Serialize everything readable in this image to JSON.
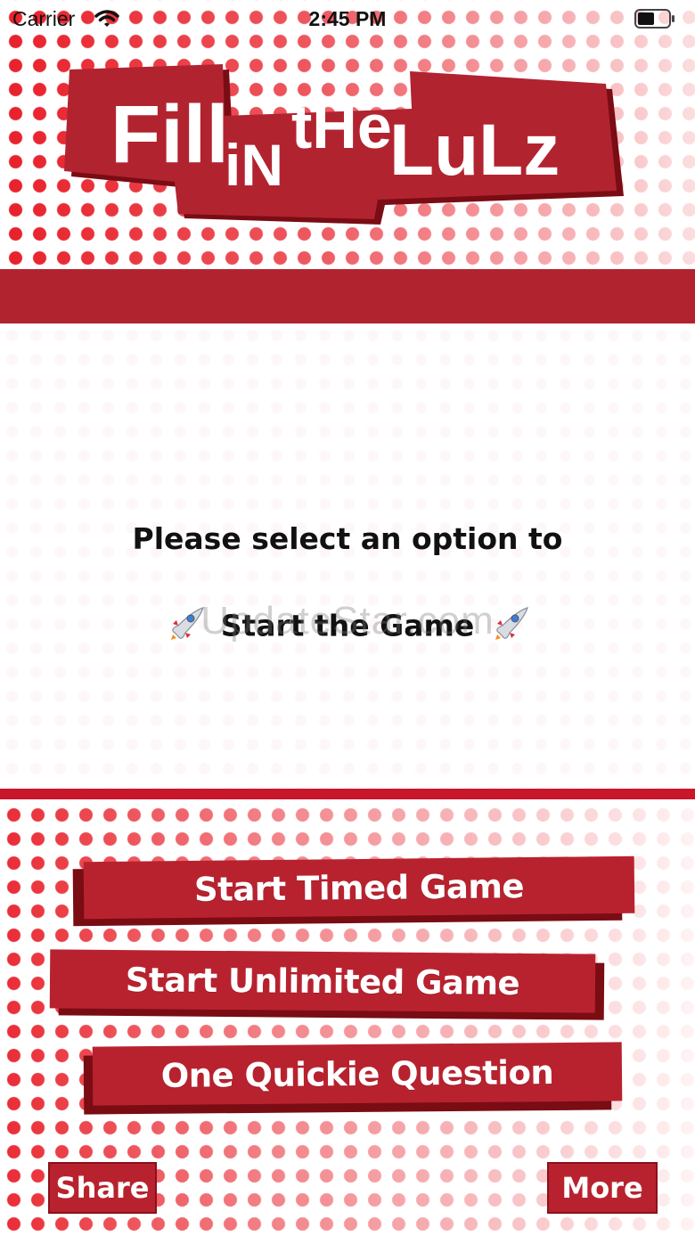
{
  "status_bar": {
    "carrier": "Carrier",
    "time": "2:45 PM"
  },
  "logo": {
    "word1": "Fill",
    "word2": "iN",
    "word3": "tHe",
    "word4": "LuLz"
  },
  "prompt": {
    "line1": "Please select an option to",
    "line2": "Start the Game"
  },
  "watermark": "UpdateStar.com",
  "buttons": {
    "timed": "Start Timed Game",
    "unlimited": "Start Unlimited Game",
    "quickie": "One Quickie Question",
    "share": "Share",
    "more": "More"
  },
  "colors": {
    "brand_red": "#b8222f",
    "dark_red": "#7a0c14",
    "dot_red": "#e8202a"
  }
}
